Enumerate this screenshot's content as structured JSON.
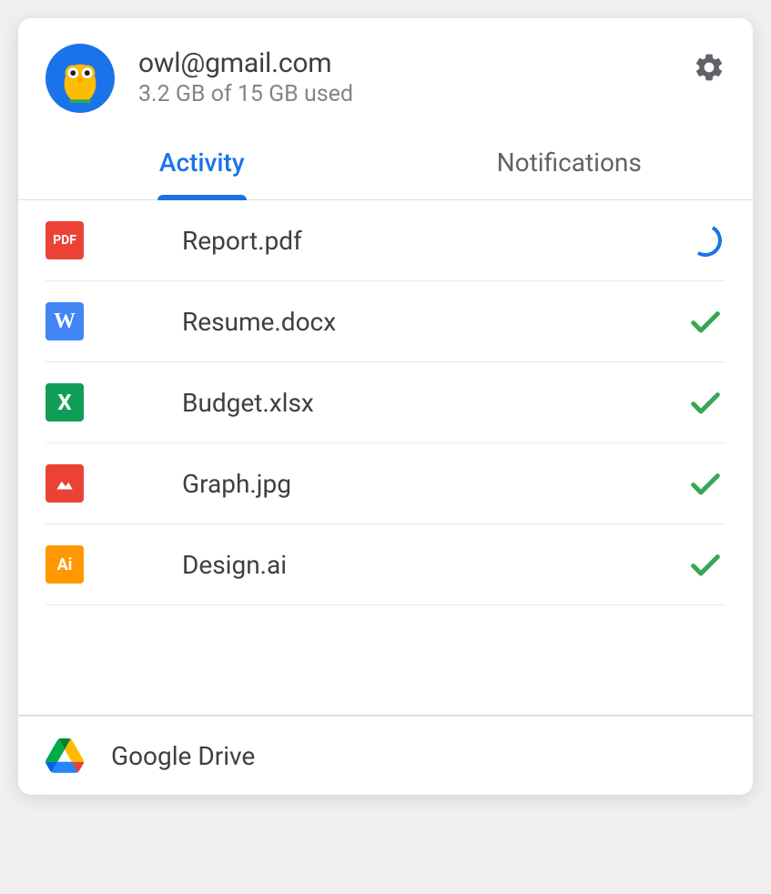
{
  "account": {
    "email": "owl@gmail.com",
    "storage": "3.2 GB of 15 GB used"
  },
  "tabs": {
    "activity": "Activity",
    "notifications": "Notifications"
  },
  "files": [
    {
      "name": "Report.pdf",
      "type": "pdf",
      "status": "syncing"
    },
    {
      "name": "Resume.docx",
      "type": "docx",
      "status": "done"
    },
    {
      "name": "Budget.xlsx",
      "type": "xlsx",
      "status": "done"
    },
    {
      "name": "Graph.jpg",
      "type": "jpg",
      "status": "done"
    },
    {
      "name": "Design.ai",
      "type": "ai",
      "status": "done"
    }
  ],
  "footer": {
    "label": "Google Drive"
  },
  "iconLabels": {
    "pdf": "PDF",
    "docx": "W",
    "xlsx": "X",
    "ai": "Ai"
  }
}
